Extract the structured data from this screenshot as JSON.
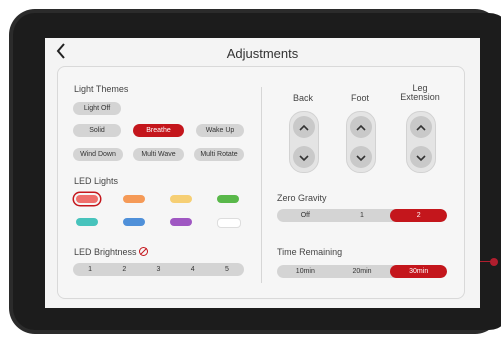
{
  "header": {
    "title": "Adjustments",
    "back_icon": "chevron-left-icon"
  },
  "light_themes": {
    "label": "Light Themes",
    "options": [
      "Light Off",
      "Solid",
      "Breathe",
      "Wake Up",
      "Wind Down",
      "Multi Wave",
      "Multi Rotate"
    ],
    "selected": "Breathe"
  },
  "led_lights": {
    "label": "LED Lights",
    "colors": [
      "#ef6f6c",
      "#f59a57",
      "#f6cf74",
      "#59b84a",
      "#47c3bc",
      "#4f90d9",
      "#9f57c2",
      "#ffffff"
    ],
    "selected_index": 0
  },
  "led_brightness": {
    "label": "LED Brightness",
    "icon": "no-sign-icon",
    "options": [
      "1",
      "2",
      "3",
      "4",
      "5"
    ]
  },
  "positions": {
    "controls": [
      {
        "label": "Back"
      },
      {
        "label": "Foot"
      },
      {
        "label": "Leg Extension"
      }
    ]
  },
  "zero_gravity": {
    "label": "Zero Gravity",
    "options": [
      "Off",
      "1",
      "2"
    ],
    "selected": "2"
  },
  "time_remaining": {
    "label": "Time Remaining",
    "options": [
      "10min",
      "20min",
      "30min"
    ],
    "selected": "30min"
  },
  "colors": {
    "accent": "#c4161c",
    "pill_bg": "#d4d4d4",
    "screen_bg": "#f4f4f4",
    "bezel": "#1c1c1c"
  }
}
